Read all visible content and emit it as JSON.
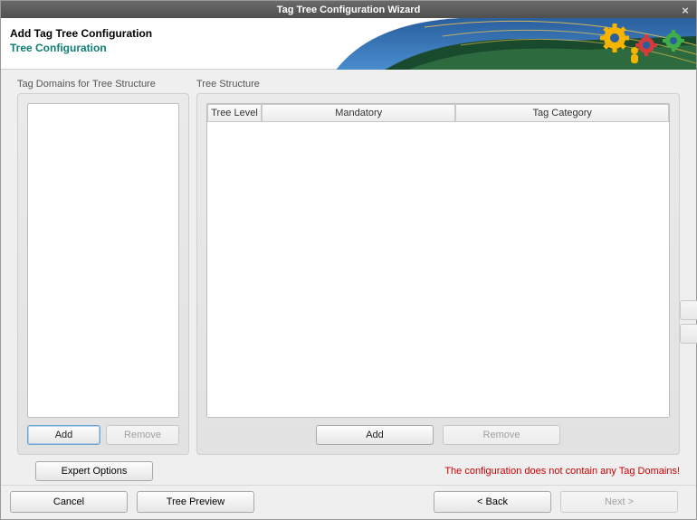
{
  "titlebar": {
    "title": "Tag Tree Configuration Wizard"
  },
  "header": {
    "line1": "Add Tag Tree Configuration",
    "line2": "Tree Configuration"
  },
  "left": {
    "label": "Tag Domains for Tree Structure",
    "add_label": "Add",
    "remove_label": "Remove"
  },
  "right": {
    "label": "Tree Structure",
    "columns": {
      "col1": "Tree Level",
      "col2": "Mandatory",
      "col3": "Tag Category"
    },
    "add_label": "Add",
    "remove_label": "Remove"
  },
  "below": {
    "expert_label": "Expert Options",
    "warning": "The configuration does not contain any Tag Domains!"
  },
  "footer": {
    "cancel": "Cancel",
    "preview": "Tree Preview",
    "back": "< Back",
    "next": "Next >"
  }
}
